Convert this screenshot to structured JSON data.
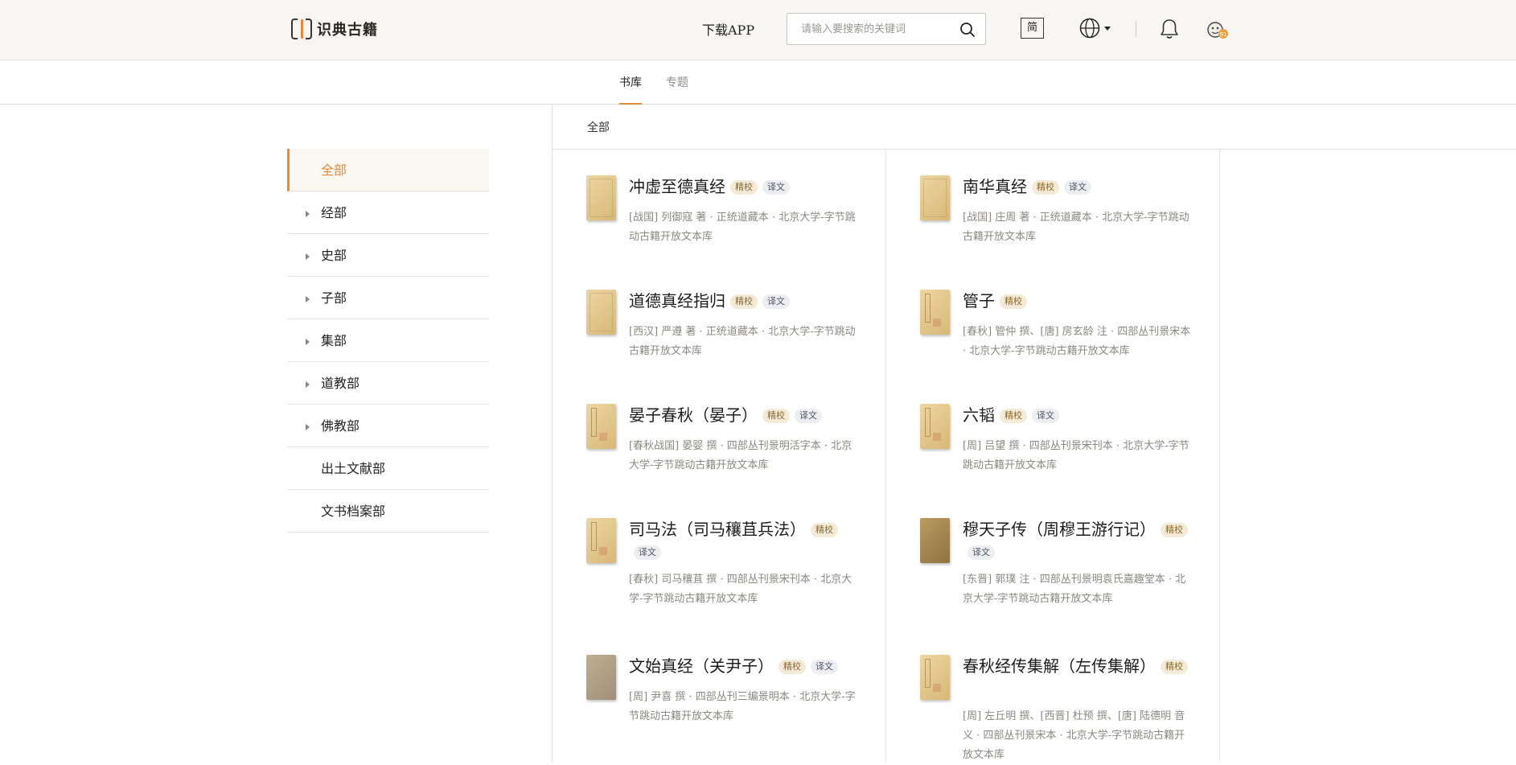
{
  "header": {
    "logo_text": "识典古籍",
    "download_label": "下载APP",
    "search_placeholder": "请输入要搜索的关键词",
    "simplified_label": "简",
    "avatar_badge": "91"
  },
  "tabs": [
    {
      "label": "书库",
      "active": true
    },
    {
      "label": "专题",
      "active": false
    }
  ],
  "breadcrumb": "全部",
  "sidebar": {
    "items": [
      {
        "label": "全部",
        "active": true,
        "expandable": false
      },
      {
        "label": "经部",
        "active": false,
        "expandable": true
      },
      {
        "label": "史部",
        "active": false,
        "expandable": true
      },
      {
        "label": "子部",
        "active": false,
        "expandable": true
      },
      {
        "label": "集部",
        "active": false,
        "expandable": true
      },
      {
        "label": "道教部",
        "active": false,
        "expandable": true
      },
      {
        "label": "佛教部",
        "active": false,
        "expandable": true
      },
      {
        "label": "出土文献部",
        "active": false,
        "expandable": false
      },
      {
        "label": "文书档案部",
        "active": false,
        "expandable": false
      }
    ]
  },
  "badges": {
    "jingjiao": "精校",
    "yiwen": "译文"
  },
  "books": [
    {
      "title": "冲虚至德真经",
      "jingjiao": true,
      "yiwen": true,
      "meta": "[战国] 列御寇 著 · 正统道藏本 · 北京大学-字节跳动古籍开放文本库",
      "cover": "plain"
    },
    {
      "title": "南华真经",
      "jingjiao": true,
      "yiwen": true,
      "meta": "[战国] 庄周 著 · 正统道藏本 · 北京大学-字节跳动古籍开放文本库",
      "cover": "plain"
    },
    {
      "title": "道德真经指归",
      "jingjiao": true,
      "yiwen": true,
      "meta": "[西汉] 严遵 著 · 正统道藏本 · 北京大学-字节跳动古籍开放文本库",
      "cover": "plain"
    },
    {
      "title": "管子",
      "jingjiao": true,
      "yiwen": false,
      "meta": "[春秋] 管仲 撰、[唐] 房玄龄 注 · 四部丛刊景宋本 · 北京大学-字节跳动古籍开放文本库",
      "cover": "ruled"
    },
    {
      "title": "晏子春秋（晏子）",
      "jingjiao": true,
      "yiwen": true,
      "meta": "[春秋战国] 晏婴 撰 · 四部丛刊景明活字本 · 北京大学-字节跳动古籍开放文本库",
      "cover": "ruled"
    },
    {
      "title": "六韬",
      "jingjiao": true,
      "yiwen": true,
      "meta": "[周] 吕望 撰 · 四部丛刊景宋刊本 · 北京大学-字节跳动古籍开放文本库",
      "cover": "ruled"
    },
    {
      "title": "司马法（司马穰苴兵法）",
      "jingjiao": true,
      "yiwen": true,
      "meta": "[春秋] 司马穰苴 撰 · 四部丛刊景宋刊本 · 北京大学-字节跳动古籍开放文本库",
      "cover": "ruled"
    },
    {
      "title": "穆天子传（周穆王游行记）",
      "jingjiao": true,
      "yiwen": true,
      "meta": "[东晋] 郭璞 注 · 四部丛刊景明袁氏嘉趣堂本 · 北京大学-字节跳动古籍开放文本库",
      "cover": "dark"
    },
    {
      "title": "文始真经（关尹子）",
      "jingjiao": true,
      "yiwen": true,
      "meta": "[周] 尹喜 撰 · 四部丛刊三编景明本 · 北京大学-字节跳动古籍开放文本库",
      "cover": "gray"
    },
    {
      "title": "春秋经传集解（左传集解）",
      "jingjiao": true,
      "yiwen": false,
      "meta": "[周] 左丘明 撰、[西晋] 杜预 撰、[唐] 陆德明 音义 · 四部丛刊景宋本 · 北京大学-字节跳动古籍开放文本库",
      "cover": "ruled"
    }
  ]
}
